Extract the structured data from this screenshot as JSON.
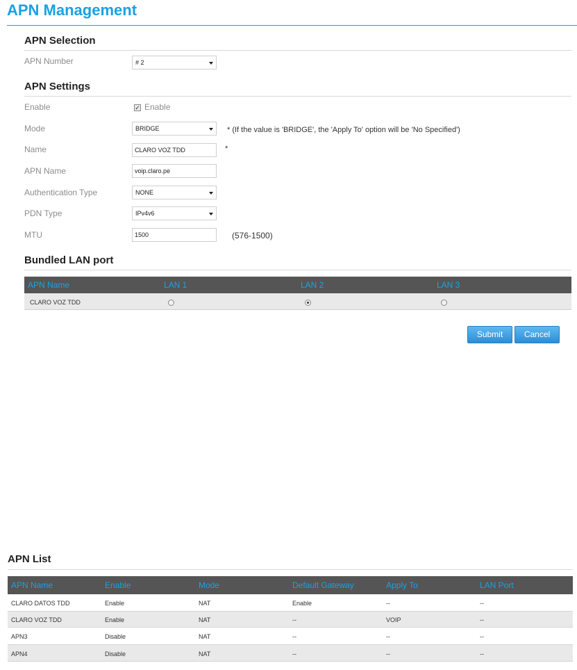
{
  "page": {
    "title": "APN Management"
  },
  "apn_selection": {
    "title": "APN Selection",
    "apn_number_label": "APN Number",
    "apn_number_value": "# 2"
  },
  "apn_settings": {
    "title": "APN Settings",
    "enable_label": "Enable",
    "enable_checkbox_label": "Enable",
    "enable_checked": true,
    "mode_label": "Mode",
    "mode_value": "BRIDGE",
    "mode_hint": "*  (If the value is 'BRIDGE', the 'Apply To' option will be 'No Specified')",
    "name_label": "Name",
    "name_value": "CLARO VOZ TDD",
    "name_required": "*",
    "apn_name_label": "APN Name",
    "apn_name_value": "voip.claro.pe",
    "auth_label": "Authentication Type",
    "auth_value": "NONE",
    "pdn_label": "PDN Type",
    "pdn_value": "IPv4v6",
    "mtu_label": "MTU",
    "mtu_value": "1500",
    "mtu_hint": "(576-1500)"
  },
  "bundled": {
    "title": "Bundled LAN port",
    "headers": [
      "APN Name",
      "LAN 1",
      "LAN 2",
      "LAN 3"
    ],
    "row_name": "CLARO VOZ TDD",
    "selected_lan": "LAN 2"
  },
  "buttons": {
    "submit": "Submit",
    "cancel": "Cancel"
  },
  "apn_list": {
    "title": "APN List",
    "headers": [
      "APN Name",
      "Enable",
      "Mode",
      "Default Gateway",
      "Apply To",
      "LAN Port"
    ],
    "rows": [
      [
        "CLARO DATOS TDD",
        "Enable",
        "NAT",
        "Enable",
        "--",
        "--"
      ],
      [
        "CLARO VOZ TDD",
        "Enable",
        "NAT",
        "--",
        "VOIP",
        "--"
      ],
      [
        "APN3",
        "Disable",
        "NAT",
        "--",
        "--",
        "--"
      ],
      [
        "APN4",
        "Disable",
        "NAT",
        "--",
        "--",
        "--"
      ]
    ]
  },
  "colors": {
    "accent": "#1ba1e2",
    "table_header_bg": "#555555",
    "row_alt_bg": "#e9e9e9"
  }
}
